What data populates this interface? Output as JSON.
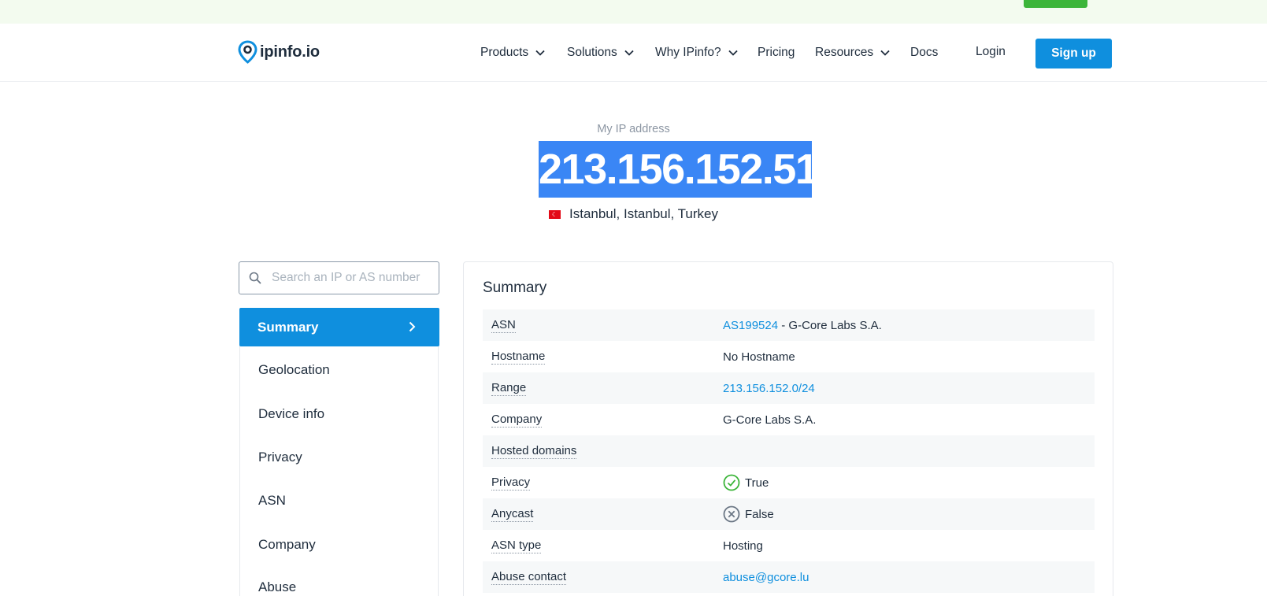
{
  "brand": {
    "logo_text": "ipinfo.io",
    "accent_color": "#0f8fde"
  },
  "nav": {
    "items": [
      {
        "label": "Products",
        "dropdown": true
      },
      {
        "label": "Solutions",
        "dropdown": true
      },
      {
        "label": "Why IPinfo?",
        "dropdown": true
      },
      {
        "label": "Pricing",
        "dropdown": false
      },
      {
        "label": "Resources",
        "dropdown": true
      },
      {
        "label": "Docs",
        "dropdown": false
      }
    ],
    "login_label": "Login",
    "signup_label": "Sign up"
  },
  "hero": {
    "label": "My IP address",
    "ip": "213.156.152.51",
    "location": "Istanbul, Istanbul, Turkey",
    "flag_icon": "turkey-flag-icon"
  },
  "search": {
    "placeholder": "Search an IP or AS number",
    "value": ""
  },
  "sidebar": {
    "items": [
      {
        "label": "Summary",
        "active": true
      },
      {
        "label": "Geolocation",
        "active": false
      },
      {
        "label": "Device info",
        "active": false
      },
      {
        "label": "Privacy",
        "active": false
      },
      {
        "label": "ASN",
        "active": false
      },
      {
        "label": "Company",
        "active": false
      },
      {
        "label": "Abuse",
        "active": false
      }
    ]
  },
  "summary": {
    "title": "Summary",
    "rows": [
      {
        "key": "ASN",
        "link": "AS199524",
        "text": " - G-Core Labs S.A."
      },
      {
        "key": "Hostname",
        "text": "No Hostname"
      },
      {
        "key": "Range",
        "link": "213.156.152.0/24"
      },
      {
        "key": "Company",
        "text": "G-Core Labs S.A."
      },
      {
        "key": "Hosted domains",
        "text": ""
      },
      {
        "key": "Privacy",
        "status": "check-circle-icon",
        "text": "True"
      },
      {
        "key": "Anycast",
        "status": "x-circle-icon",
        "text": "False"
      },
      {
        "key": "ASN type",
        "text": "Hosting"
      },
      {
        "key": "Abuse contact",
        "link": "abuse@gcore.lu"
      }
    ]
  }
}
